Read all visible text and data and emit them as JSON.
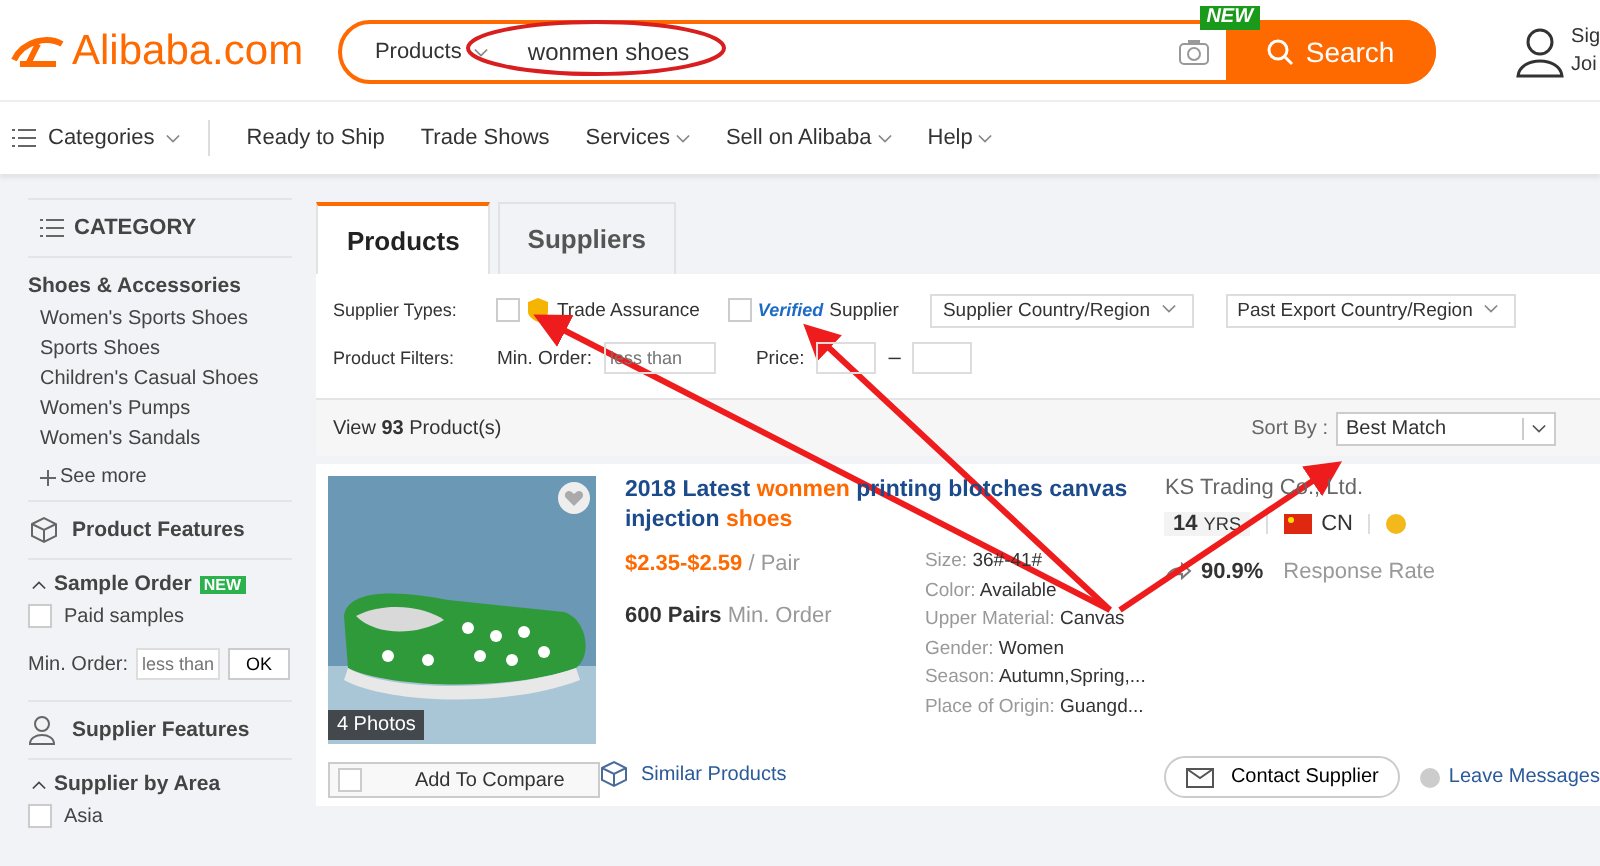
{
  "header": {
    "logo": "Alibaba.com",
    "search": {
      "scope": "Products",
      "value": "wonmen shoes",
      "button": "Search",
      "badge": "NEW"
    },
    "account": [
      "Sig",
      "Joi"
    ]
  },
  "nav": {
    "categories": "Categories",
    "items": [
      {
        "label": "Ready to Ship",
        "dropdown": false
      },
      {
        "label": "Trade Shows",
        "dropdown": false
      },
      {
        "label": "Services",
        "dropdown": true
      },
      {
        "label": "Sell on Alibaba",
        "dropdown": true
      },
      {
        "label": "Help",
        "dropdown": true
      }
    ]
  },
  "sidebar": {
    "title": "CATEGORY",
    "group": "Shoes & Accessories",
    "items": [
      "Women's Sports Shoes",
      "Sports Shoes",
      "Children's Casual Shoes",
      "Women's Pumps",
      "Women's Sandals"
    ],
    "see_more": "See more",
    "product_features": "Product Features",
    "sample_order": {
      "title": "Sample Order",
      "badge": "NEW",
      "option": {
        "label": "Paid samples",
        "checked": false
      },
      "min_order_label": "Min. Order:",
      "min_order_placeholder": "less than",
      "ok": "OK"
    },
    "supplier_features": "Supplier Features",
    "supplier_area": {
      "title": "Supplier by Area",
      "option": {
        "label": "Asia",
        "checked": false
      }
    }
  },
  "tabs": [
    {
      "label": "Products",
      "selected": true
    },
    {
      "label": "Suppliers",
      "selected": false
    }
  ],
  "filters": {
    "supplier_types_label": "Supplier Types:",
    "types": [
      {
        "kind": "assurance",
        "label": "Trade Assurance",
        "checked": false
      },
      {
        "kind": "verified",
        "mark": "Verified",
        "label": "Supplier",
        "checked": false
      }
    ],
    "dropdowns": [
      "Supplier Country/Region",
      "Past Export Country/Region"
    ],
    "product_filters_label": "Product Filters:",
    "min_order_label": "Min. Order:",
    "min_order_placeholder": "less than",
    "price_label": "Price:",
    "price_separator": "–"
  },
  "results": {
    "count_prefix": "View",
    "count": "93",
    "count_suffix": "Product(s)",
    "sort_label": "Sort By :",
    "sort_value": "Best Match"
  },
  "product": {
    "photos": "4 Photos",
    "title": [
      {
        "text": "2018 Latest ",
        "highlight": false
      },
      {
        "text": "wonmen",
        "highlight": true
      },
      {
        "text": " printing blotches canvas injection ",
        "highlight": false
      },
      {
        "text": "shoes",
        "highlight": true
      }
    ],
    "price": "$2.35-$2.59",
    "price_unit": "/ Pair",
    "min_order": "600 Pairs",
    "min_order_label": "Min. Order",
    "specs": [
      {
        "label": "Size:",
        "value": "36#-41#"
      },
      {
        "label": "Color:",
        "value": "Available"
      },
      {
        "label": "Upper Material:",
        "value": "Canvas"
      },
      {
        "label": "Gender:",
        "value": "Women"
      },
      {
        "label": "Season:",
        "value": "Autumn,Spring,..."
      },
      {
        "label": "Place of Origin:",
        "value": "Guangd..."
      }
    ],
    "supplier": "KS Trading Co., Ltd.",
    "years": "14",
    "years_unit": "YRS",
    "country": "CN",
    "response_rate": "90.9%",
    "response_label": "Response Rate",
    "compare": {
      "label": "Add To Compare",
      "checked": false
    },
    "similar": "Similar Products",
    "contact": "Contact Supplier",
    "leave": "Leave Messages"
  }
}
